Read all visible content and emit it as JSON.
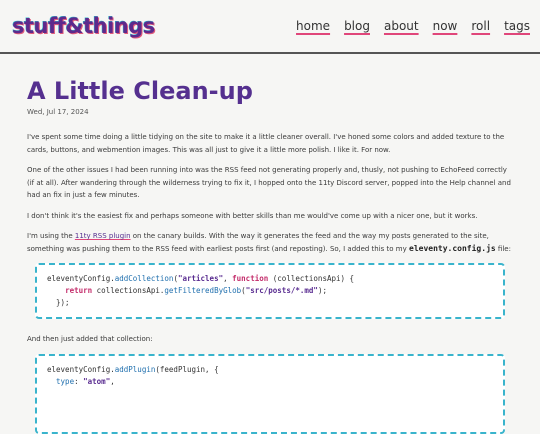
{
  "header": {
    "logo": "stuff&things",
    "nav": [
      "home",
      "blog",
      "about",
      "now",
      "roll",
      "tags"
    ]
  },
  "post": {
    "title": "A Little Clean-up",
    "date": "Wed, Jul 17, 2024",
    "p1": "I've spent some time doing a little tidying on the site to make it a little cleaner overall. I've honed some colors and added texture to the cards, buttons, and webmention images. This was all just to give it a little more polish. I like it. For now.",
    "p2": "One of the other issues I had been running into was the RSS feed not generating properly and, thusly, not pushing to EchoFeed correctly (if at all). After wandering through the wilderness trying to fix it, I hopped onto the 11ty Discord server, popped into the Help channel and had an fix in just a few minutes.",
    "p3": "I don't think it's the easiest fix and perhaps someone with better skills than me would've come up with a nicer one, but it works.",
    "p4_before": "I'm using the ",
    "p4_link": "11ty RSS plugin",
    "p4_mid": " on the canary builds. With the way it generates the feed and the way my posts generated to the site, something was pushing them to the RSS feed with earliest posts first (and reposting). So, I added this to my ",
    "p4_code": "eleventy.config.js",
    "p4_after": " file:",
    "p5": "And then just added that collection:"
  },
  "code1": {
    "l1_obj": "eleventyConfig.",
    "l1_fn": "addCollection",
    "l1_a": "(",
    "l1_str": "\"articles\"",
    "l1_b": ", ",
    "l1_kw": "function",
    "l1_c": " (collectionsApi) {",
    "l2_kw": "return",
    "l2_a": " collectionsApi.",
    "l2_fn": "getFilteredByGlob",
    "l2_b": "(",
    "l2_str": "\"src/posts/*.md\"",
    "l2_c": ");",
    "l3": "});"
  },
  "code2": {
    "l1_obj": "eleventyConfig.",
    "l1_fn": "addPlugin",
    "l1_a": "(feedPlugin, {",
    "l2_prop": "type",
    "l2_a": ": ",
    "l2_str": "\"atom\"",
    "l2_b": ","
  },
  "colors": {
    "accent": "#55308f",
    "underline": "#e0467a",
    "code_border": "#39b4cc"
  }
}
